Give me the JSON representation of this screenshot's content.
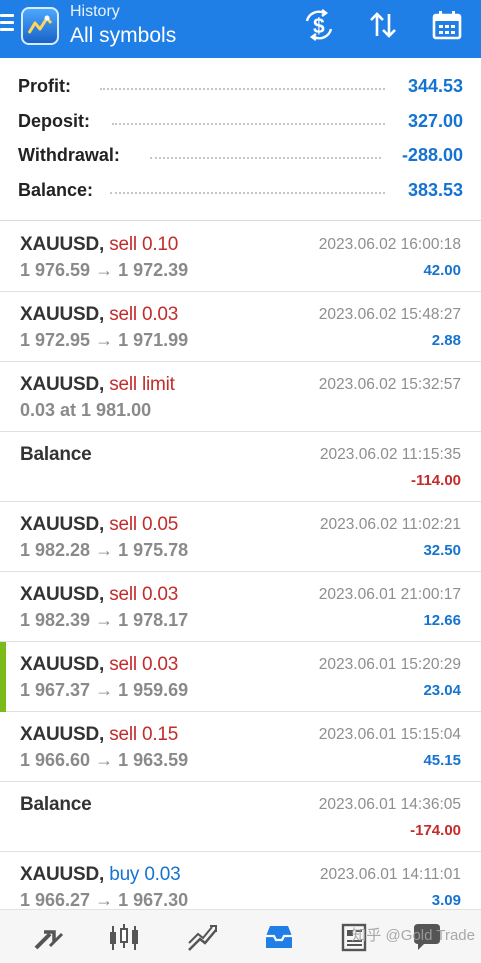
{
  "header": {
    "subtitle": "History",
    "title": "All symbols",
    "actions": [
      "currency-exchange-icon",
      "sort-icon",
      "calendar-icon"
    ],
    "accent": "#1f7fe6"
  },
  "summary": [
    {
      "label": "Profit:",
      "value": "344.53"
    },
    {
      "label": "Deposit:",
      "value": "327.00"
    },
    {
      "label": "Withdrawal:",
      "value": "-288.00"
    },
    {
      "label": "Balance:",
      "value": "383.53"
    }
  ],
  "deals": [
    {
      "symbol": "XAUUSD,",
      "type": "sell 0.10",
      "side": "sell",
      "price": "1 976.59 → 1 972.39",
      "time": "2023.06.02 16:00:18",
      "profit": "42.00",
      "sign": "pos"
    },
    {
      "symbol": "XAUUSD,",
      "type": "sell 0.03",
      "side": "sell",
      "price": "1 972.95 → 1 971.99",
      "time": "2023.06.02 15:48:27",
      "profit": "2.88",
      "sign": "pos"
    },
    {
      "symbol": "XAUUSD,",
      "type": "sell limit",
      "side": "sell",
      "price": "0.03 at 1 981.00",
      "time": "2023.06.02 15:32:57",
      "profit": "",
      "sign": "pos"
    },
    {
      "symbol": "Balance",
      "type": "",
      "side": "none",
      "price": "",
      "time": "2023.06.02 11:15:35",
      "profit": "-114.00",
      "sign": "neg"
    },
    {
      "symbol": "XAUUSD,",
      "type": "sell 0.05",
      "side": "sell",
      "price": "1 982.28 → 1 975.78",
      "time": "2023.06.02 11:02:21",
      "profit": "32.50",
      "sign": "pos"
    },
    {
      "symbol": "XAUUSD,",
      "type": "sell 0.03",
      "side": "sell",
      "price": "1 982.39 → 1 978.17",
      "time": "2023.06.01 21:00:17",
      "profit": "12.66",
      "sign": "pos"
    },
    {
      "symbol": "XAUUSD,",
      "type": "sell 0.03",
      "side": "sell",
      "price": "1 967.37 → 1 959.69",
      "time": "2023.06.01 15:20:29",
      "profit": "23.04",
      "sign": "pos",
      "marked": true
    },
    {
      "symbol": "XAUUSD,",
      "type": "sell 0.15",
      "side": "sell",
      "price": "1 966.60 → 1 963.59",
      "time": "2023.06.01 15:15:04",
      "profit": "45.15",
      "sign": "pos"
    },
    {
      "symbol": "Balance",
      "type": "",
      "side": "none",
      "price": "",
      "time": "2023.06.01 14:36:05",
      "profit": "-174.00",
      "sign": "neg"
    },
    {
      "symbol": "XAUUSD,",
      "type": "buy 0.03",
      "side": "buy",
      "price": "1 966.27 → 1 967.30",
      "time": "2023.06.01 14:11:01",
      "profit": "3.09",
      "sign": "pos"
    }
  ],
  "bottom_nav": [
    "quotes-icon",
    "chart-icon",
    "trade-icon",
    "history-icon",
    "news-icon",
    "chat-icon"
  ],
  "watermark": "知乎 @Gold Trade"
}
